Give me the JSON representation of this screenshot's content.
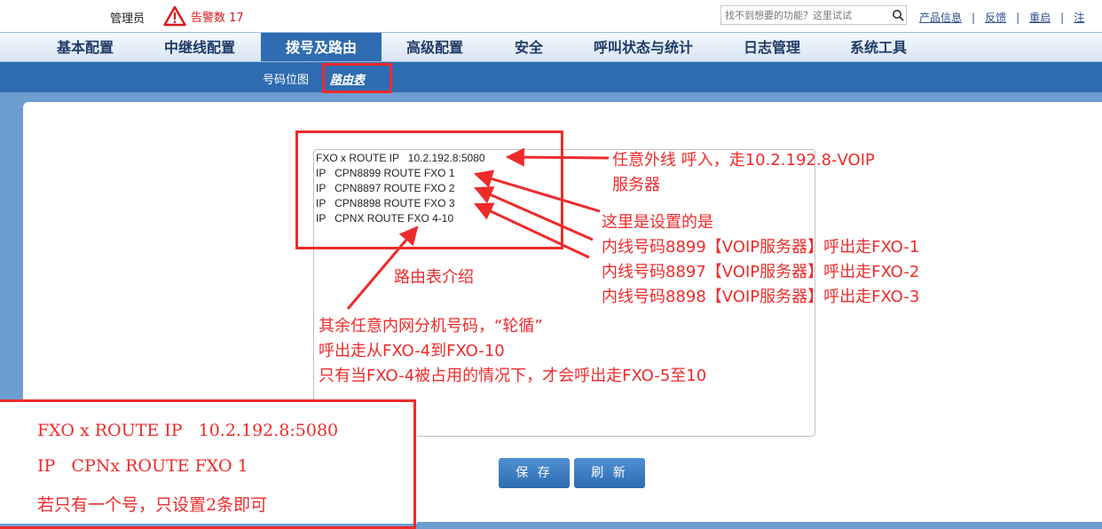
{
  "header": {
    "admin_label": "管理员",
    "alarm_label": "告警数 17",
    "search_placeholder": "找不到想要的功能？这里试试",
    "links": [
      "产品信息",
      "反馈",
      "重启",
      "注"
    ]
  },
  "nav": {
    "tabs": [
      "基本配置",
      "中继线配置",
      "拨号及路由",
      "高级配置",
      "安全",
      "呼叫状态与统计",
      "日志管理",
      "系统工具"
    ],
    "active_tab": "拨号及路由"
  },
  "subnav": {
    "items": [
      "号码位图",
      "路由表"
    ],
    "active_item": "路由表"
  },
  "route_table": {
    "lines": [
      "FXO x ROUTE IP   10.2.192.8:5080",
      "IP   CPN8899 ROUTE FXO 1",
      "IP   CPN8897 ROUTE FXO 2",
      "IP   CPN8898 ROUTE FXO 3",
      "IP   CPNX ROUTE FXO 4-10"
    ]
  },
  "buttons": {
    "save": "保 存",
    "refresh": "刷 新"
  },
  "annotations": {
    "note1": [
      "任意外线 呼入，走10.2.192.8-VOIP",
      "服务器"
    ],
    "note2": [
      "这里是设置的是",
      "内线号码8899【VOIP服务器】呼出走FXO-1",
      "内线号码8897【VOIP服务器】呼出走FXO-2",
      "内线号码8898【VOIP服务器】呼出走FXO-3"
    ],
    "note3": "路由表介绍",
    "note4": [
      "其余任意内网分机号码，“轮循”",
      "呼出走从FXO-4到FXO-10",
      "只有当FXO-4被占用的情况下，才会呼出走FXO-5至10"
    ],
    "bottom_note": [
      "FXO x ROUTE IP   10.2.192.8:5080",
      "IP   CPNx ROUTE FXO 1",
      "若只有一个号，只设置2条即可"
    ]
  },
  "colors": {
    "accent": "#2f6cb1",
    "annotation_red": "#ee2b2b",
    "alarm_red": "#d9191b"
  }
}
